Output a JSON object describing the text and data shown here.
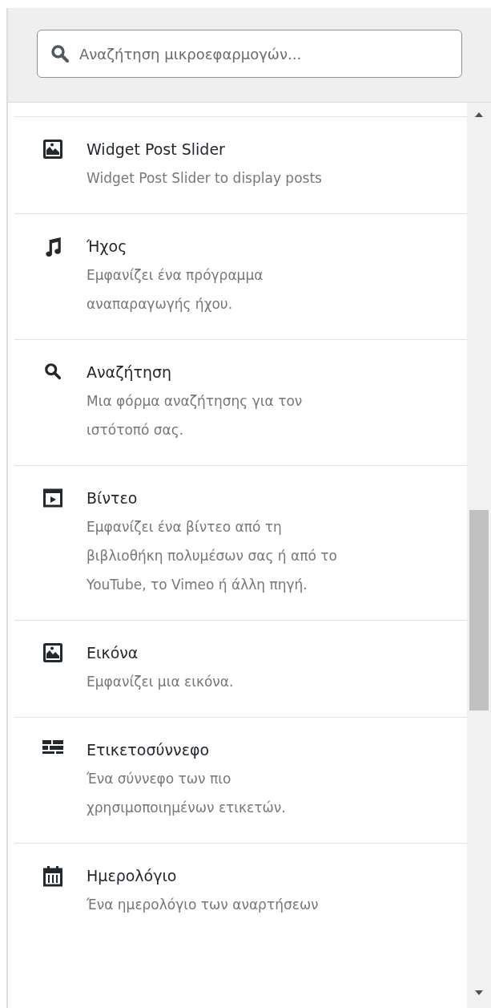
{
  "search": {
    "placeholder": "Αναζήτηση μικροεφαρμογών..."
  },
  "widgets": [
    {
      "kind": "image",
      "title": "Widget Post Slider",
      "description": "Widget Post Slider to display posts"
    },
    {
      "kind": "audio",
      "title": "Ήχος",
      "description": "Εμφανίζει ένα πρόγραμμα αναπαραγωγής ήχου."
    },
    {
      "kind": "search",
      "title": "Αναζήτηση",
      "description": "Μια φόρμα αναζήτησης για τον ιστότοπό σας."
    },
    {
      "kind": "video",
      "title": "Βίντεο",
      "description": "Εμφανίζει ένα βίντεο από τη βιβλιοθήκη πολυμέσων σας ή από το YouTube, το Vimeo ή άλλη πηγή."
    },
    {
      "kind": "image",
      "title": "Εικόνα",
      "description": "Εμφανίζει μια εικόνα."
    },
    {
      "kind": "tagcloud",
      "title": "Ετικετοσύννεφο",
      "description": "Ένα σύννεφο των πιο χρησιμοποιημένων ετικετών."
    },
    {
      "kind": "calendar",
      "title": "Ημερολόγιο",
      "description": "Ένα ημερολόγιο των αναρτήσεων"
    }
  ]
}
